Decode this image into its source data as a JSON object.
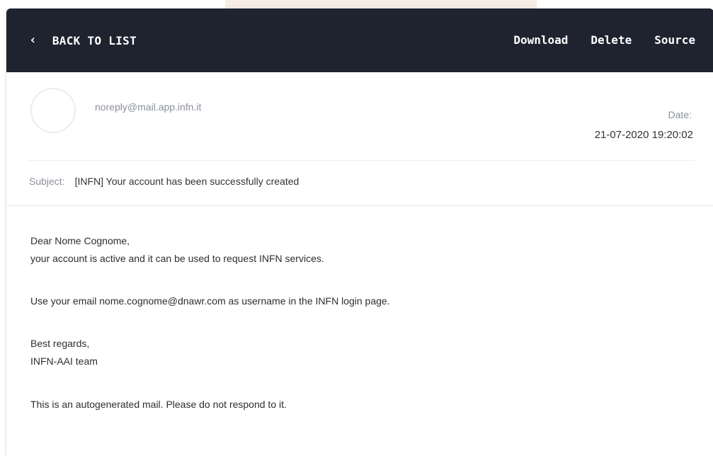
{
  "toolbar": {
    "back_label": "BACK TO LIST",
    "back_icon": "chevron-left-icon",
    "download_label": "Download",
    "delete_label": "Delete",
    "source_label": "Source"
  },
  "email": {
    "sender": "noreply@mail.app.infn.it",
    "date_label": "Date:",
    "date_value": "21-07-2020 19:20:02",
    "subject_label": "Subject:",
    "subject_value": "[INFN] Your account has been successfully created",
    "body": {
      "greeting": "Dear Nome Cognome,",
      "line1": "your account is active and it can be used to request INFN services.",
      "line2": "Use your email nome.cognome@dnawr.com as username in the INFN login page.",
      "regards": "Best regards,",
      "team": "INFN-AAI team",
      "footer": "This is an autogenerated mail. Please do not respond to it."
    }
  },
  "colors": {
    "topbar_bg": "#1f2330",
    "muted_text": "#8a8f99",
    "body_text": "#2e2e2e"
  }
}
